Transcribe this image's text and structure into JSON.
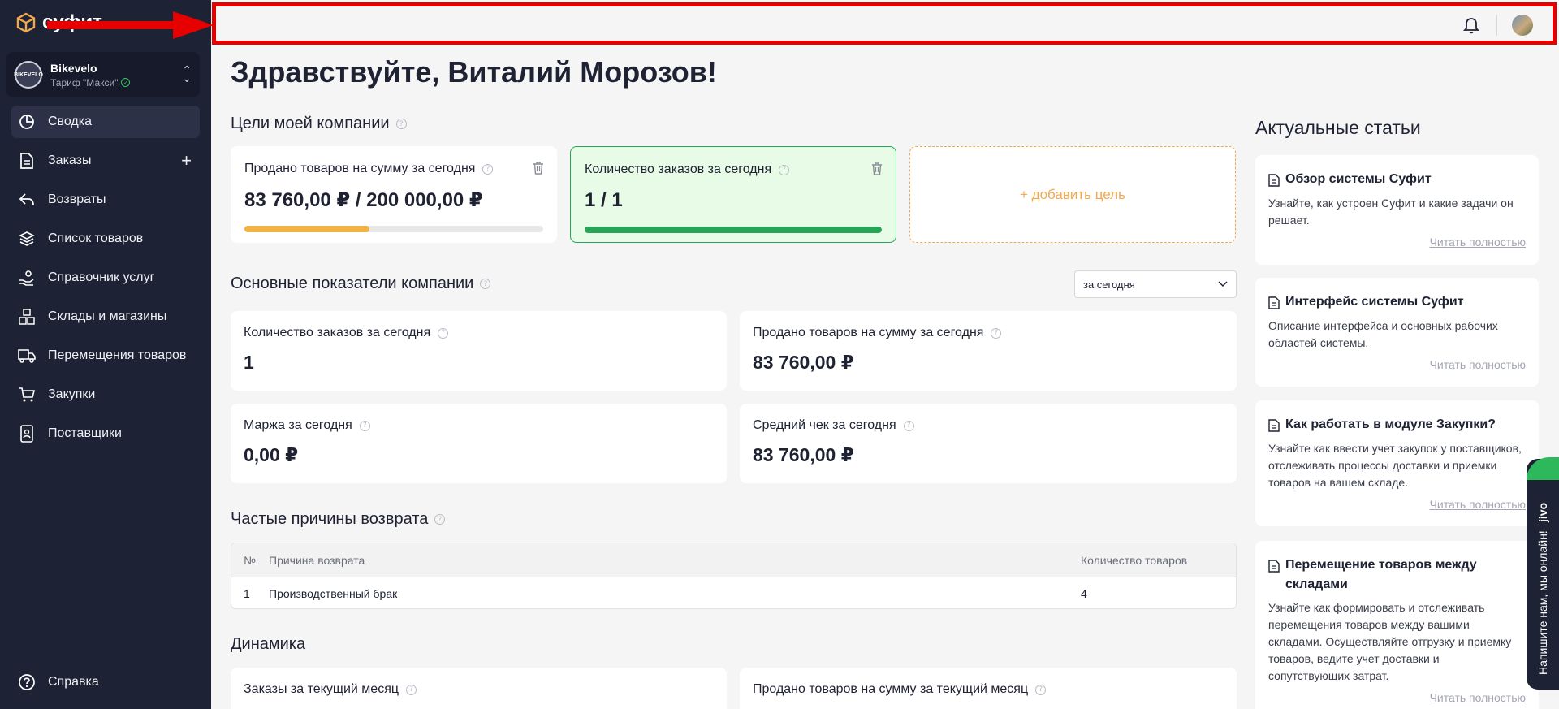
{
  "app": {
    "logo_text": "суфит",
    "company_name": "Bikevelo",
    "company_plan": "Тариф \"Макси\"",
    "company_avatar_text": "BIKEVELO"
  },
  "sidebar": {
    "items": [
      {
        "label": "Сводка",
        "icon": "pie-chart-icon",
        "active": true
      },
      {
        "label": "Заказы",
        "icon": "document-icon"
      },
      {
        "label": "Возвраты",
        "icon": "return-arrow-icon"
      },
      {
        "label": "Список товаров",
        "icon": "layers-icon"
      },
      {
        "label": "Справочник услуг",
        "icon": "hand-service-icon"
      },
      {
        "label": "Склады и магазины",
        "icon": "boxes-icon"
      },
      {
        "label": "Перемещения товаров",
        "icon": "truck-icon"
      },
      {
        "label": "Закупки",
        "icon": "cart-icon"
      },
      {
        "label": "Поставщики",
        "icon": "contact-book-icon"
      }
    ],
    "help_label": "Справка"
  },
  "greeting": "Здравствуйте, Виталий Морозов!",
  "goals": {
    "title": "Цели моей компании",
    "cards": [
      {
        "label": "Продано товаров на сумму за сегодня",
        "value": "83 760,00 ₽ / 200 000,00 ₽",
        "progress": 0.419,
        "color": "#f2b244"
      },
      {
        "label": "Количество заказов за сегодня",
        "value": "1 / 1",
        "progress": 1.0,
        "color": "#27a556"
      }
    ],
    "add_label": "+ добавить цель"
  },
  "kpi": {
    "title": "Основные показатели компании",
    "period": "за сегодня",
    "cards": [
      {
        "label": "Количество заказов за сегодня",
        "value": "1"
      },
      {
        "label": "Продано товаров на сумму за сегодня",
        "value": "83 760,00 ₽"
      },
      {
        "label": "Маржа за сегодня",
        "value": "0,00 ₽"
      },
      {
        "label": "Средний чек за сегодня",
        "value": "83 760,00 ₽"
      }
    ]
  },
  "returns": {
    "title": "Частые причины возврата",
    "columns": [
      "№",
      "Причина возврата",
      "Количество товаров"
    ],
    "rows": [
      [
        "1",
        "Производственный брак",
        "4"
      ]
    ]
  },
  "dynamics": {
    "title": "Динамика",
    "cards": [
      "Заказы за текущий месяц",
      "Продано товаров на сумму за текущий месяц"
    ]
  },
  "articles": {
    "title": "Актуальные статьи",
    "read_more": "Читать полностью",
    "items": [
      {
        "title": "Обзор системы Суфит",
        "desc": "Узнайте, как устроен Суфит и какие задачи он решает."
      },
      {
        "title": "Интерфейс системы Суфит",
        "desc": "Описание интерфейса и основных рабочих областей системы."
      },
      {
        "title": "Как работать в модуле Закупки?",
        "desc": "Узнайте как ввести учет закупок у поставщиков, отслеживать процессы доставки и приемки товаров на вашем складе."
      },
      {
        "title": "Перемещение товаров между складами",
        "desc": "Узнайте как формировать и отслеживать перемещения товаров между вашими складами. Осуществляйте отгрузку и приемку товаров, ведите учет доставки и сопутствующих затрат."
      }
    ]
  },
  "jivo": {
    "label": "Напишите нам, мы онлайн!",
    "brand": "jivo"
  },
  "colors": {
    "sidebar": "#1e2235",
    "accent_orange": "#f2a94d",
    "accent_green": "#27a556",
    "highlight_red": "#e60000"
  }
}
